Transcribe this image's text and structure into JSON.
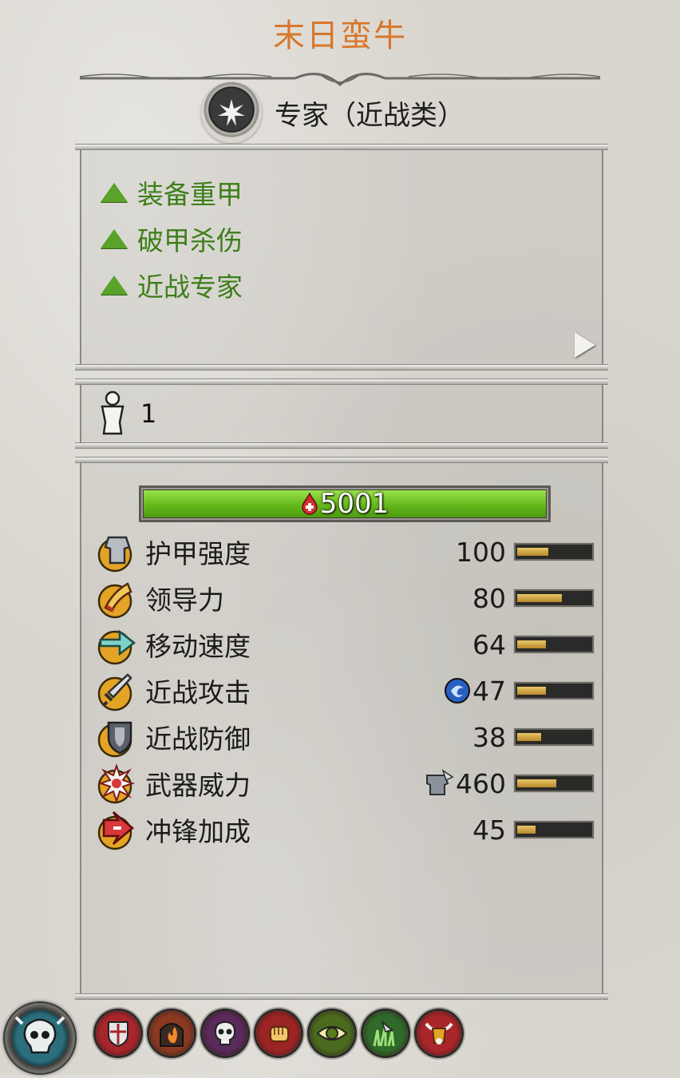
{
  "unit": {
    "name": "末日蛮牛"
  },
  "class_row": {
    "label": "专家（近战类）",
    "icon": "starburst-icon"
  },
  "attributes": [
    {
      "label": "装备重甲",
      "icon": "green-up-triangle-icon"
    },
    {
      "label": "破甲杀伤",
      "icon": "green-up-triangle-icon"
    },
    {
      "label": "近战专家",
      "icon": "green-up-triangle-icon"
    }
  ],
  "unit_count": {
    "value": "1",
    "icon": "soldier-silhouette-icon"
  },
  "health": {
    "value": "5001",
    "fraction": 1.0,
    "icon": "blood-drop-icon"
  },
  "stats": [
    {
      "label": "护甲强度",
      "value": "100",
      "fill": 0.45,
      "icon": "armour-icon"
    },
    {
      "label": "领导力",
      "value": "80",
      "fill": 0.62,
      "icon": "leadership-horn-icon"
    },
    {
      "label": "移动速度",
      "value": "64",
      "fill": 0.42,
      "icon": "speed-arrow-icon"
    },
    {
      "label": "近战攻击",
      "value": "47",
      "fill": 0.42,
      "icon": "sword-icon",
      "badge": "blue-rune-icon"
    },
    {
      "label": "近战防御",
      "value": "38",
      "fill": 0.35,
      "icon": "shield-icon"
    },
    {
      "label": "武器威力",
      "value": "460",
      "fill": 0.55,
      "icon": "weapon-strength-icon",
      "badge": "armour-piercing-icon"
    },
    {
      "label": "冲锋加成",
      "value": "45",
      "fill": 0.28,
      "icon": "charge-bonus-icon"
    }
  ],
  "abilities": [
    {
      "name": "shield-banner-icon",
      "color": "#a8262b"
    },
    {
      "name": "fire-gate-icon",
      "color": "#8a3a22"
    },
    {
      "name": "skull-icon",
      "color": "#5a2a5a"
    },
    {
      "name": "fist-icon",
      "color": "#9b2424"
    },
    {
      "name": "eye-icon",
      "color": "#4a6a1e"
    },
    {
      "name": "grass-cursor-icon",
      "color": "#2f6a2a"
    },
    {
      "name": "bull-head-icon",
      "color": "#a9262b"
    }
  ],
  "colors": {
    "title": "#d9762a",
    "attribute_text": "#3d7e1a",
    "health": "#64b81c",
    "stat_bar": "#c8982f"
  }
}
